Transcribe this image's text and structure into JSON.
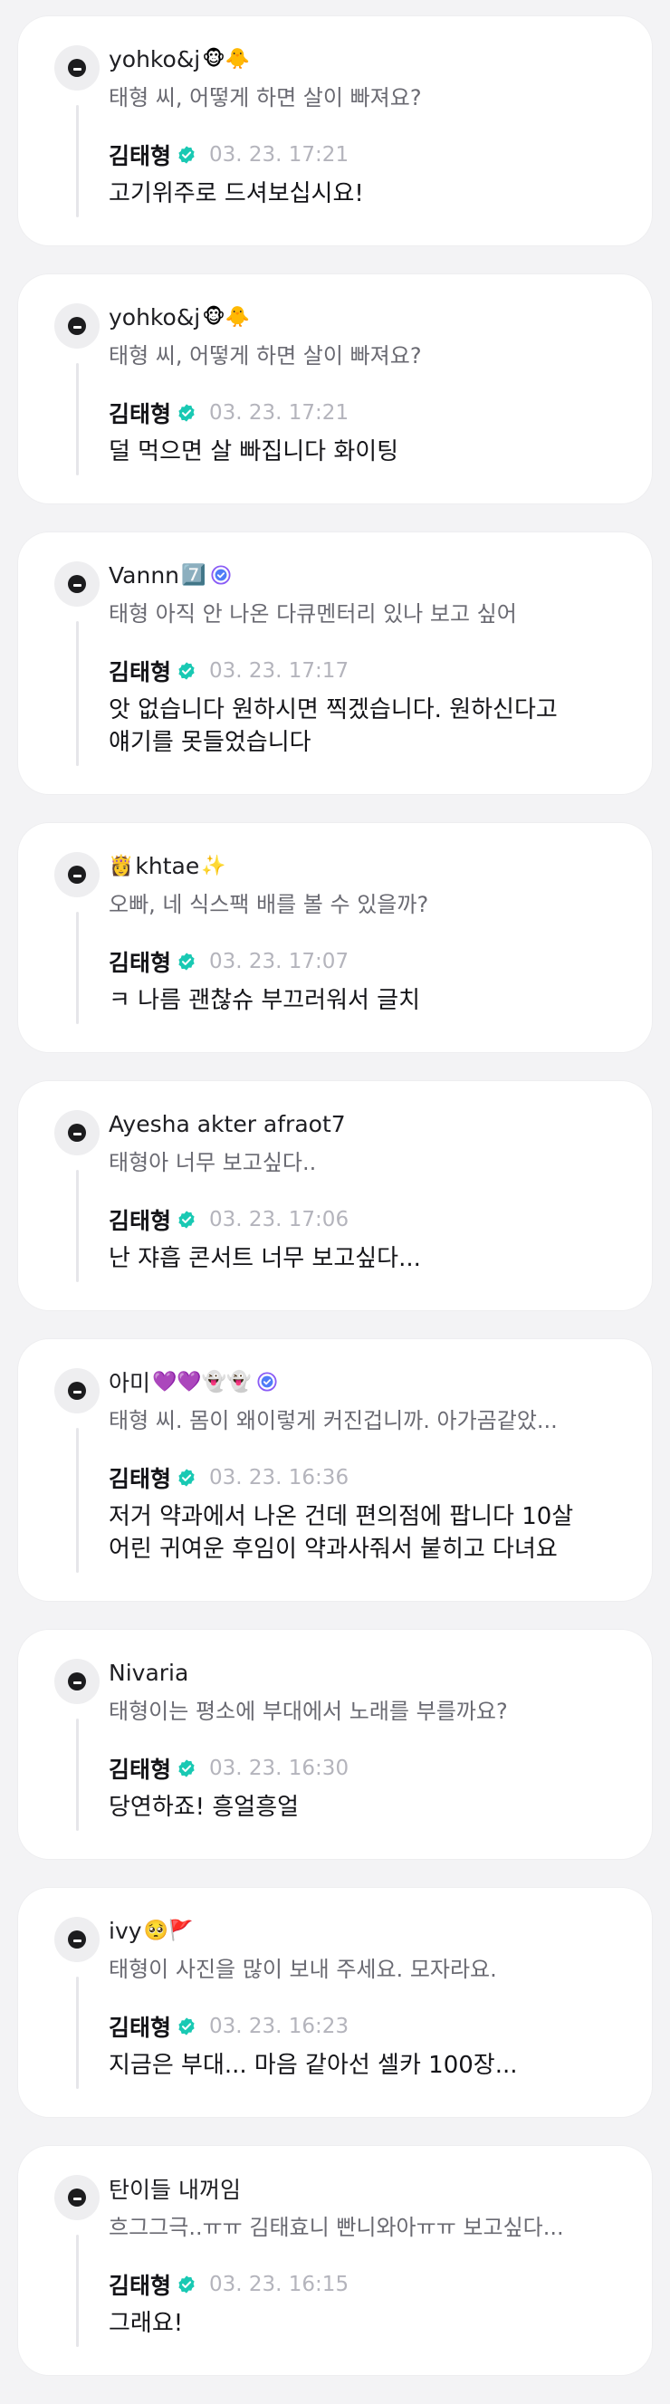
{
  "artist": "김태형",
  "threads": [
    {
      "fan_name": "yohko&j",
      "fan_emoji": "🐵🐥",
      "fan_verified": false,
      "fan_message": "태형 씨, 어떻게 하면 살이 빠져요?",
      "reply_time": "03. 23. 17:21",
      "reply_lines": [
        "고기위주로 드셔보십시요!"
      ]
    },
    {
      "fan_name": "yohko&j",
      "fan_emoji": "🐵🐥",
      "fan_verified": false,
      "fan_message": "태형 씨, 어떻게 하면 살이 빠져요?",
      "reply_time": "03. 23. 17:21",
      "reply_lines": [
        "덜 먹으면 살 빠집니다 화이팅"
      ]
    },
    {
      "fan_name": "Vannn",
      "fan_emoji": "7️⃣",
      "fan_verified": true,
      "fan_message": "태형 아직 안 나온 다큐멘터리 있나 보고 싶어",
      "reply_time": "03. 23. 17:17",
      "reply_lines": [
        "앗 없습니다 원하시면 찍겠습니다. 원하신다고",
        "얘기를 못들었습니다"
      ]
    },
    {
      "fan_name": "khtae",
      "fan_emoji_before": "👸",
      "fan_emoji": "✨",
      "fan_verified": false,
      "fan_message": "오빠, 네 식스팩 배를 볼 수 있을까?",
      "reply_time": "03. 23. 17:07",
      "reply_lines": [
        "ㅋ 나름 괜찮슈 부끄러워서 글치"
      ]
    },
    {
      "fan_name": "Ayesha akter afraot7",
      "fan_emoji": "",
      "fan_verified": false,
      "fan_message": "태형아 너무 보고싶다..",
      "reply_time": "03. 23. 17:06",
      "reply_lines": [
        "난 쟈흡 콘서트 너무 보고싶다..."
      ]
    },
    {
      "fan_name": "아미",
      "fan_emoji": "💜💜👻👻",
      "fan_verified": true,
      "fan_message": "태형 씨. 몸이 왜이렇게 커진겁니까. 아가곰같았...",
      "reply_time": "03. 23. 16:36",
      "reply_lines": [
        "저거 약과에서 나온 건데 편의점에 팝니다 10살",
        "어린 귀여운 후임이 약과사줘서 붙히고 다녀요"
      ]
    },
    {
      "fan_name": "Nivaria",
      "fan_emoji": "",
      "fan_verified": false,
      "fan_message": "태형이는 평소에 부대에서 노래를 부를까요?",
      "reply_time": "03. 23. 16:30",
      "reply_lines": [
        "당연하죠! 흥얼흥얼"
      ]
    },
    {
      "fan_name": "ivy",
      "fan_emoji": "🥺🚩",
      "fan_verified": false,
      "fan_message": "태형이 사진을 많이 보내 주세요. 모자라요.",
      "reply_time": "03. 23. 16:23",
      "reply_lines": [
        "지금은 부대... 마음 같아선 셀카 100장..."
      ]
    },
    {
      "fan_name": "탄이들 내꺼임",
      "fan_emoji": "",
      "fan_verified": false,
      "fan_message": "흐그그극..ㅠㅠ 김태효니 빤니와아ㅠㅠ 보고싶다...",
      "reply_time": "03. 23. 16:15",
      "reply_lines": [
        "그래요!"
      ]
    }
  ]
}
